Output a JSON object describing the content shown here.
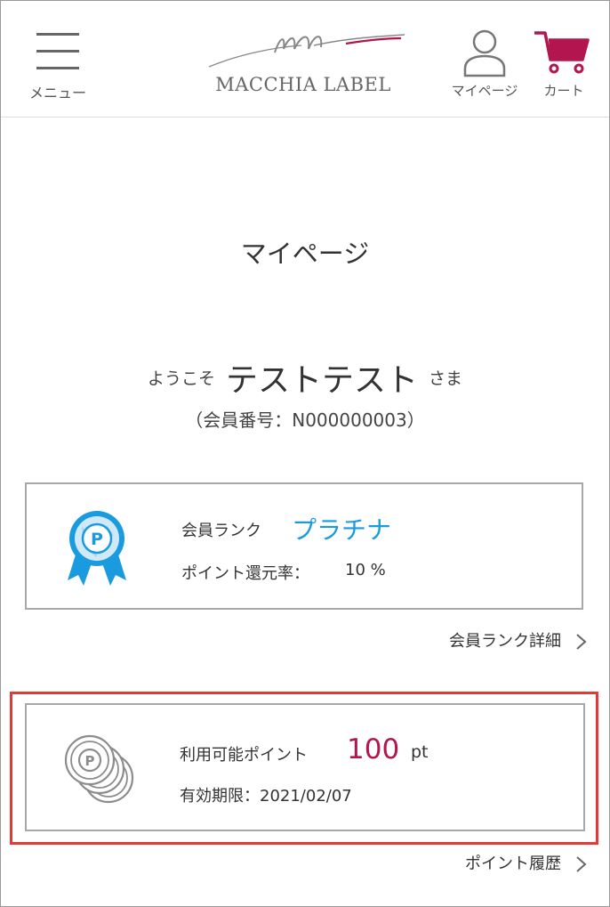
{
  "header": {
    "menu_label": "メニュー",
    "logo_text": "MACCHIA LABEL",
    "mypage_label": "マイページ",
    "cart_label": "カート",
    "brand_color": "#b3164f"
  },
  "page": {
    "title": "マイページ"
  },
  "welcome": {
    "prefix": "ようこそ",
    "name": "テストテスト",
    "suffix": "さま",
    "member_number": "（会員番号：N000000003）"
  },
  "rank": {
    "label": "会員ランク",
    "value": "プラチナ",
    "value_color": "#1a9be0",
    "rate_label": "ポイント還元率：",
    "rate_value": "10 %",
    "icon": "platinum-rank-ribbon-icon",
    "detail_link": "会員ランク詳細"
  },
  "points": {
    "label": "利用可能ポイント",
    "value": "100",
    "unit": "pt",
    "expiry": "有効期限：2021/02/07",
    "icon": "point-coins-icon",
    "history_link": "ポイント履歴"
  }
}
